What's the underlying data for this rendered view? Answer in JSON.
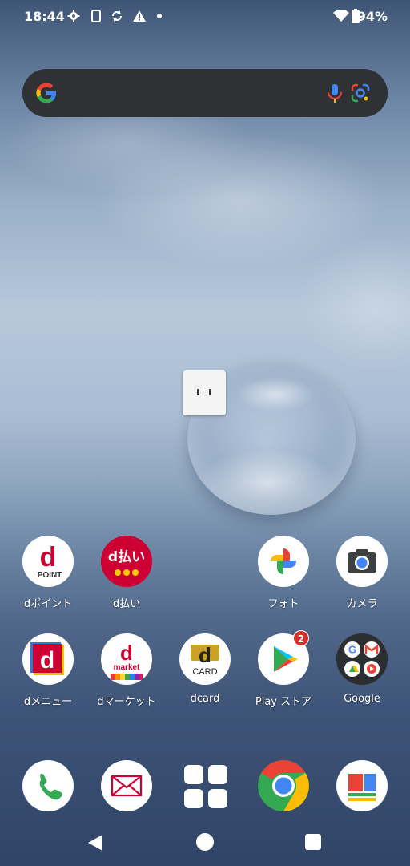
{
  "status_bar": {
    "time": "18:44",
    "battery_percent": "94%",
    "icons": [
      "gear-icon",
      "phone-icon",
      "sync-icon",
      "warning-icon",
      "dot-icon",
      "wifi-icon",
      "battery-icon"
    ]
  },
  "search": {
    "icons": [
      "google-g-icon",
      "mic-icon",
      "lens-icon"
    ]
  },
  "apps": {
    "row1": [
      {
        "label": "dポイント",
        "icon": "dpoint-icon",
        "icon_text": "d",
        "icon_subtext": "POINT"
      },
      {
        "label": "d払い",
        "icon": "dpay-icon",
        "icon_text": "d払い"
      },
      {
        "label": "フォト",
        "icon": "photos-icon"
      },
      {
        "label": "カメラ",
        "icon": "camera-icon"
      }
    ],
    "row2": [
      {
        "label": "dメニュー",
        "icon": "dmenu-icon",
        "icon_text": "d"
      },
      {
        "label": "dマーケット",
        "icon": "dmarket-icon",
        "icon_text": "d",
        "icon_subtext": "market"
      },
      {
        "label": "dcard",
        "icon": "dcard-icon",
        "icon_text": "d",
        "icon_subtext": "CARD"
      },
      {
        "label": "Play ストア",
        "icon": "play-store-icon",
        "badge": "2"
      },
      {
        "label": "Google",
        "icon": "google-folder-icon"
      }
    ]
  },
  "dock": [
    "phone-dial-icon",
    "mail-icon",
    "app-drawer-icon",
    "chrome-icon",
    "news-icon"
  ],
  "nav": [
    "back-icon",
    "home-icon",
    "recents-icon"
  ],
  "colors": {
    "docomo_red": "#cc0033",
    "search_bg": "#2f3134",
    "badge": "#d93025"
  }
}
